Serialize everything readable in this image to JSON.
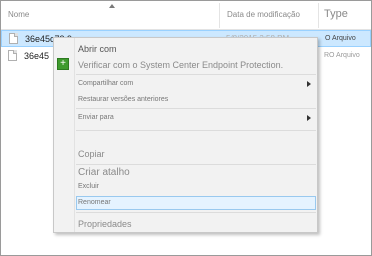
{
  "columns": {
    "name": "Nome",
    "date": "Data de modificação",
    "type": "Type"
  },
  "files": [
    {
      "name": "36e45c73.9",
      "date": "5/8/2015 3:58 PM",
      "type": "O Arquivo"
    },
    {
      "name": "36e45",
      "date": "",
      "type": "RO Arquivo"
    }
  ],
  "menu": {
    "open": "Abrir com",
    "scan": "Verificar com o System Center Endpoint Protection.",
    "share": "Compartilhar com",
    "restore": "Restaurar versões anteriores",
    "send_to": "Enviar para",
    "copy": "Copiar",
    "shortcut": "Criar atalho",
    "delete": "Excluir",
    "rename": "Renomear",
    "properties": "Propriedades"
  },
  "icons": {
    "file": "file-icon",
    "shield": "shield-icon",
    "submenu": "chevron-right-icon"
  },
  "colors": {
    "selection_bg": "#cce8ff",
    "menu_bg": "#f2f2f2",
    "highlight_border": "#99c9ef"
  }
}
